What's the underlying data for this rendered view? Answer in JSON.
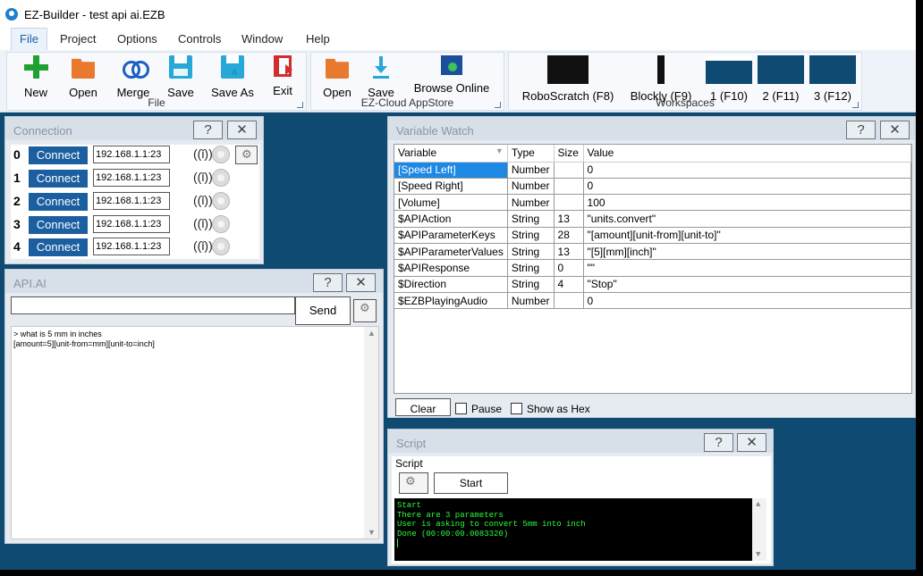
{
  "window": {
    "title": "EZ-Builder - test api ai.EZB"
  },
  "menu": [
    "File",
    "Project",
    "Options",
    "Controls",
    "Window",
    "Help"
  ],
  "ribbon": {
    "file_group": {
      "label": "File",
      "buttons": [
        "New",
        "Open",
        "Merge",
        "Save",
        "Save As",
        "Exit"
      ]
    },
    "cloud_group": {
      "label": "EZ-Cloud AppStore",
      "buttons": [
        "Open",
        "Save",
        "Browse  Online"
      ]
    },
    "workspaces_group": {
      "label": "Workspaces",
      "buttons": [
        "RoboScratch (F8)",
        "Blockly (F9)",
        "1 (F10)",
        "2 (F11)",
        "3 (F12)"
      ]
    }
  },
  "panel_buttons": {
    "help": "?",
    "close": "✕"
  },
  "connection": {
    "title": "Connection",
    "rows": [
      {
        "num": "0",
        "button": "Connect",
        "ip": "192.168.1.1:23"
      },
      {
        "num": "1",
        "button": "Connect",
        "ip": "192.168.1.1:23"
      },
      {
        "num": "2",
        "button": "Connect",
        "ip": "192.168.1.1:23"
      },
      {
        "num": "3",
        "button": "Connect",
        "ip": "192.168.1.1:23"
      },
      {
        "num": "4",
        "button": "Connect",
        "ip": "192.168.1.1:23"
      }
    ]
  },
  "apiai": {
    "title": "API.AI",
    "input_value": "",
    "send_label": "Send",
    "log_lines": [
      "> what is 5 mm in inches",
      "[amount=5][unit-from=mm][unit-to=inch]"
    ]
  },
  "variable_watch": {
    "title": "Variable Watch",
    "columns": [
      "Variable",
      "Type",
      "Size",
      "Value"
    ],
    "rows": [
      [
        "[Speed Left]",
        "Number",
        "",
        "0"
      ],
      [
        "[Speed Right]",
        "Number",
        "",
        "0"
      ],
      [
        "[Volume]",
        "Number",
        "",
        "100"
      ],
      [
        "$APIAction",
        "String",
        "13",
        "\"units.convert\""
      ],
      [
        "$APIParameterKeys",
        "String",
        "28",
        "\"[amount][unit-from][unit-to]\""
      ],
      [
        "$APIParameterValues",
        "String",
        "13",
        "\"[5][mm][inch]\""
      ],
      [
        "$APIResponse",
        "String",
        "0",
        "\"\""
      ],
      [
        "$Direction",
        "String",
        "4",
        "\"Stop\""
      ],
      [
        "$EZBPlayingAudio",
        "Number",
        "",
        "0"
      ]
    ],
    "clear_label": "Clear",
    "pause_label": "Pause",
    "hex_label": "Show as Hex"
  },
  "script": {
    "title": "Script",
    "label": "Script",
    "start_label": "Start",
    "console_lines": [
      "Start",
      "There are 3 parameters",
      "User is asking to convert 5mm into inch",
      "Done (00:00:00.0083320)"
    ]
  },
  "colors": {
    "workspace_bg": "#0f4a72",
    "accent": "#1c5fa0",
    "console_text": "#2bff3c"
  }
}
